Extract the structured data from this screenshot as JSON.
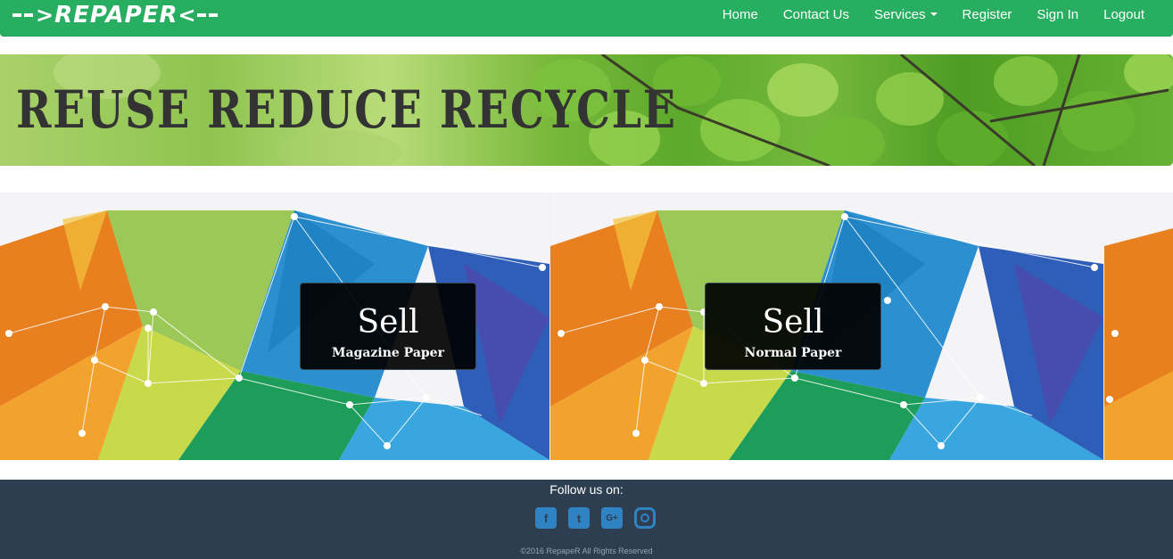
{
  "brand": {
    "name": "REPAPER"
  },
  "nav": {
    "home": "Home",
    "contact": "Contact Us",
    "services": "Services",
    "register": "Register",
    "signin": "Sign In",
    "logout": "Logout"
  },
  "banner": {
    "title": "REUSE REDUCE RECYCLE"
  },
  "cards": [
    {
      "title": "Sell",
      "subtitle": "Magazine Paper"
    },
    {
      "title": "Sell",
      "subtitle": "Normal Paper"
    }
  ],
  "footer": {
    "follow": "Follow us on:",
    "socials": [
      "facebook-icon",
      "twitter-icon",
      "google-plus-icon",
      "instagram-icon"
    ],
    "copyright": "©2016 RepapeR All Rights Reserved"
  },
  "colors": {
    "navbar": "#27ae60",
    "footer": "#2c3e50",
    "social": "#2f83c3"
  }
}
